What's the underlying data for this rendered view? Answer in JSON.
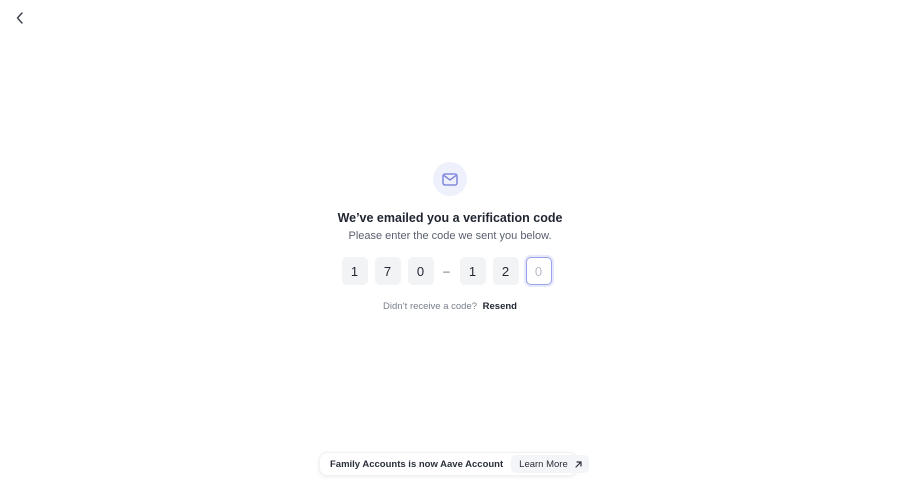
{
  "header": {
    "back_icon": "chevron-left-icon"
  },
  "verification": {
    "icon": "mail-icon",
    "title": "We’ve emailed you a verification code",
    "subtitle": "Please enter the code we sent you below.",
    "code_digits": [
      "1",
      "7",
      "0",
      "1",
      "2"
    ],
    "separator": "–",
    "active_placeholder": "0",
    "resend_prompt": "Didn’t receive a code?",
    "resend_label": "Resend"
  },
  "banner": {
    "text": "Family Accounts is now Aave Account",
    "learn_more_label": "Learn More",
    "learn_more_icon": "arrow-up-right-icon"
  },
  "colors": {
    "accent": "#9ba3e8",
    "badge_bg": "#eef0fb",
    "box_bg": "#f2f3f5"
  }
}
